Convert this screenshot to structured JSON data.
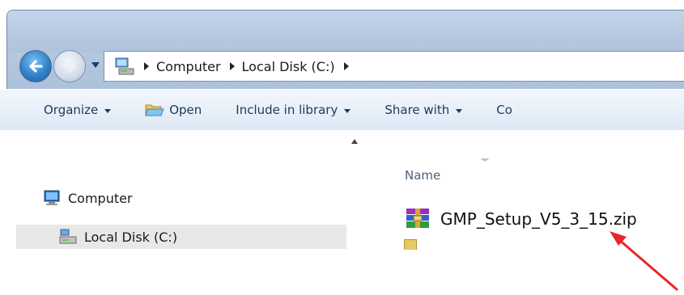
{
  "navigation": {
    "back_icon": "back-arrow-icon",
    "forward_icon": "forward-arrow-icon",
    "breadcrumb": [
      "Computer",
      "Local Disk (C:)"
    ]
  },
  "toolbar": {
    "organize": "Organize",
    "open": "Open",
    "include_in_library": "Include in library",
    "share_with": "Share with",
    "clipped": "Co"
  },
  "nav_pane": {
    "items": [
      {
        "label": "Computer",
        "icon": "computer-icon"
      },
      {
        "label": "Local Disk (C:)",
        "icon": "local-disk-icon",
        "selected": true
      }
    ]
  },
  "file_list": {
    "column_name": "Name",
    "files": [
      {
        "name": "GMP_Setup_V5_3_15.zip",
        "icon": "winrar-archive-icon"
      }
    ]
  },
  "annotation": {
    "type": "red-arrow",
    "color": "#e8262b"
  },
  "colors": {
    "title_bar": "#b7c9e0",
    "toolbar_text": "#1e395b",
    "selection": "#e8e8e8"
  }
}
